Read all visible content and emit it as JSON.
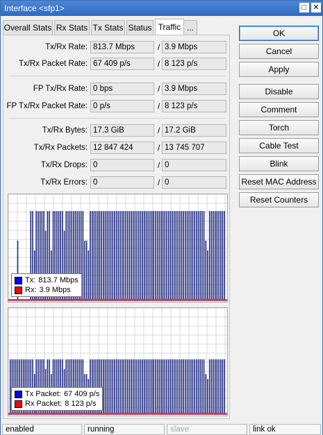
{
  "window": {
    "title": "Interface <sfp1>"
  },
  "tabs": [
    {
      "label": "Overall Stats"
    },
    {
      "label": "Rx Stats"
    },
    {
      "label": "Tx Stats"
    },
    {
      "label": "Status"
    },
    {
      "label": "Traffic",
      "active": true
    },
    {
      "label": "..."
    }
  ],
  "traffic": {
    "rate": {
      "label": "Tx/Rx Rate:",
      "tx": "813.7 Mbps",
      "rx": "3.9 Mbps"
    },
    "packet_rate": {
      "label": "Tx/Rx Packet Rate:",
      "tx": "67 409 p/s",
      "rx": "8 123 p/s"
    },
    "fp_rate": {
      "label": "FP Tx/Rx Rate:",
      "tx": "0 bps",
      "rx": "3.9 Mbps"
    },
    "fp_packet_rate": {
      "label": "FP Tx/Rx Packet Rate:",
      "tx": "0 p/s",
      "rx": "8 123 p/s"
    },
    "bytes": {
      "label": "Tx/Rx Bytes:",
      "tx": "17.3 GiB",
      "rx": "17.2 GiB"
    },
    "packets": {
      "label": "Tx/Rx Packets:",
      "tx": "12 847 424",
      "rx": "13 745 707"
    },
    "drops": {
      "label": "Tx/Rx Drops:",
      "tx": "0",
      "rx": "0"
    },
    "errors": {
      "label": "Tx/Rx Errors:",
      "tx": "0",
      "rx": "0"
    },
    "separator": "/"
  },
  "graphs": {
    "traffic_legend": {
      "tx_label": "Tx:",
      "tx_value": "813.7 Mbps",
      "rx_label": "Rx:",
      "rx_value": "3.9 Mbps",
      "tx_color": "#0000ff",
      "rx_color": "#ff0000"
    },
    "packet_legend": {
      "tx_label": "Tx Packet:",
      "tx_value": "67 409 p/s",
      "rx_label": "Rx Packet:",
      "rx_value": "8 123 p/s",
      "tx_color": "#0000ff",
      "rx_color": "#ff0000"
    },
    "bar_color": "#1f2a80",
    "rx_bar_color": "#b0204a",
    "traffic_levels": [
      0.0,
      0.0,
      0.0,
      0.0,
      0.6,
      0.0,
      0.0,
      0.0,
      0.0,
      0.0,
      0.0,
      0.9,
      0.9,
      0.5,
      0.9,
      0.9,
      0.9,
      0.9,
      0.9,
      0.7,
      0.9,
      0.9,
      0.5,
      0.9,
      0.9,
      0.9,
      0.9,
      0.9,
      0.9,
      0.7,
      0.9,
      0.9,
      0.9,
      0.9,
      0.9,
      0.9,
      0.9,
      0.9,
      0.9,
      0.9,
      0.6,
      0.6,
      0.5,
      0.9,
      0.9,
      0.9,
      0.9,
      0.9,
      0.9,
      0.9,
      0.9,
      0.9,
      0.9,
      0.9,
      0.9,
      0.9,
      0.9,
      0.9,
      0.9,
      0.9,
      0.9,
      0.9,
      0.9,
      0.9,
      0.9,
      0.9,
      0.9,
      0.9,
      0.9,
      0.9,
      0.9,
      0.9,
      0.9,
      0.9,
      0.9,
      0.9,
      0.9,
      0.9,
      0.9,
      0.9,
      0.9,
      0.9,
      0.9,
      0.9,
      0.9,
      0.9,
      0.9,
      0.9,
      0.9,
      0.9,
      0.9,
      0.9,
      0.9,
      0.9,
      0.9,
      0.9,
      0.9,
      0.9,
      0.9,
      0.9,
      0.9,
      0.9,
      0.9,
      0.9,
      0.9,
      0.6,
      0.5,
      0.9,
      0.9,
      0.9,
      0.9,
      0.9,
      0.9,
      0.9,
      0.9,
      0.9
    ],
    "packet_levels": [
      0.55,
      0.55,
      0.55,
      0.55,
      0.55,
      0.55,
      0.55,
      0.55,
      0.55,
      0.55,
      0.55,
      0.55,
      0.55,
      0.4,
      0.55,
      0.55,
      0.55,
      0.55,
      0.55,
      0.45,
      0.55,
      0.55,
      0.4,
      0.55,
      0.55,
      0.55,
      0.55,
      0.55,
      0.55,
      0.45,
      0.55,
      0.55,
      0.55,
      0.55,
      0.55,
      0.55,
      0.55,
      0.55,
      0.55,
      0.55,
      0.4,
      0.4,
      0.35,
      0.55,
      0.55,
      0.55,
      0.55,
      0.55,
      0.55,
      0.55,
      0.55,
      0.55,
      0.55,
      0.55,
      0.55,
      0.55,
      0.55,
      0.55,
      0.55,
      0.55,
      0.55,
      0.55,
      0.55,
      0.55,
      0.55,
      0.55,
      0.55,
      0.55,
      0.55,
      0.55,
      0.55,
      0.55,
      0.55,
      0.55,
      0.55,
      0.55,
      0.55,
      0.55,
      0.55,
      0.55,
      0.55,
      0.55,
      0.55,
      0.55,
      0.55,
      0.55,
      0.55,
      0.55,
      0.55,
      0.55,
      0.55,
      0.55,
      0.55,
      0.55,
      0.55,
      0.55,
      0.55,
      0.55,
      0.55,
      0.55,
      0.55,
      0.55,
      0.55,
      0.55,
      0.55,
      0.4,
      0.35,
      0.55,
      0.55,
      0.55,
      0.55,
      0.55,
      0.55,
      0.55,
      0.55,
      0.55
    ]
  },
  "buttons": {
    "ok": "OK",
    "cancel": "Cancel",
    "apply": "Apply",
    "disable": "Disable",
    "comment": "Comment",
    "torch": "Torch",
    "cable_test": "Cable Test",
    "blink": "Blink",
    "reset_mac": "Reset MAC Address",
    "reset_counters": "Reset Counters"
  },
  "status": {
    "enabled": "enabled",
    "running": "running",
    "slave": "slave",
    "link": "link ok"
  }
}
